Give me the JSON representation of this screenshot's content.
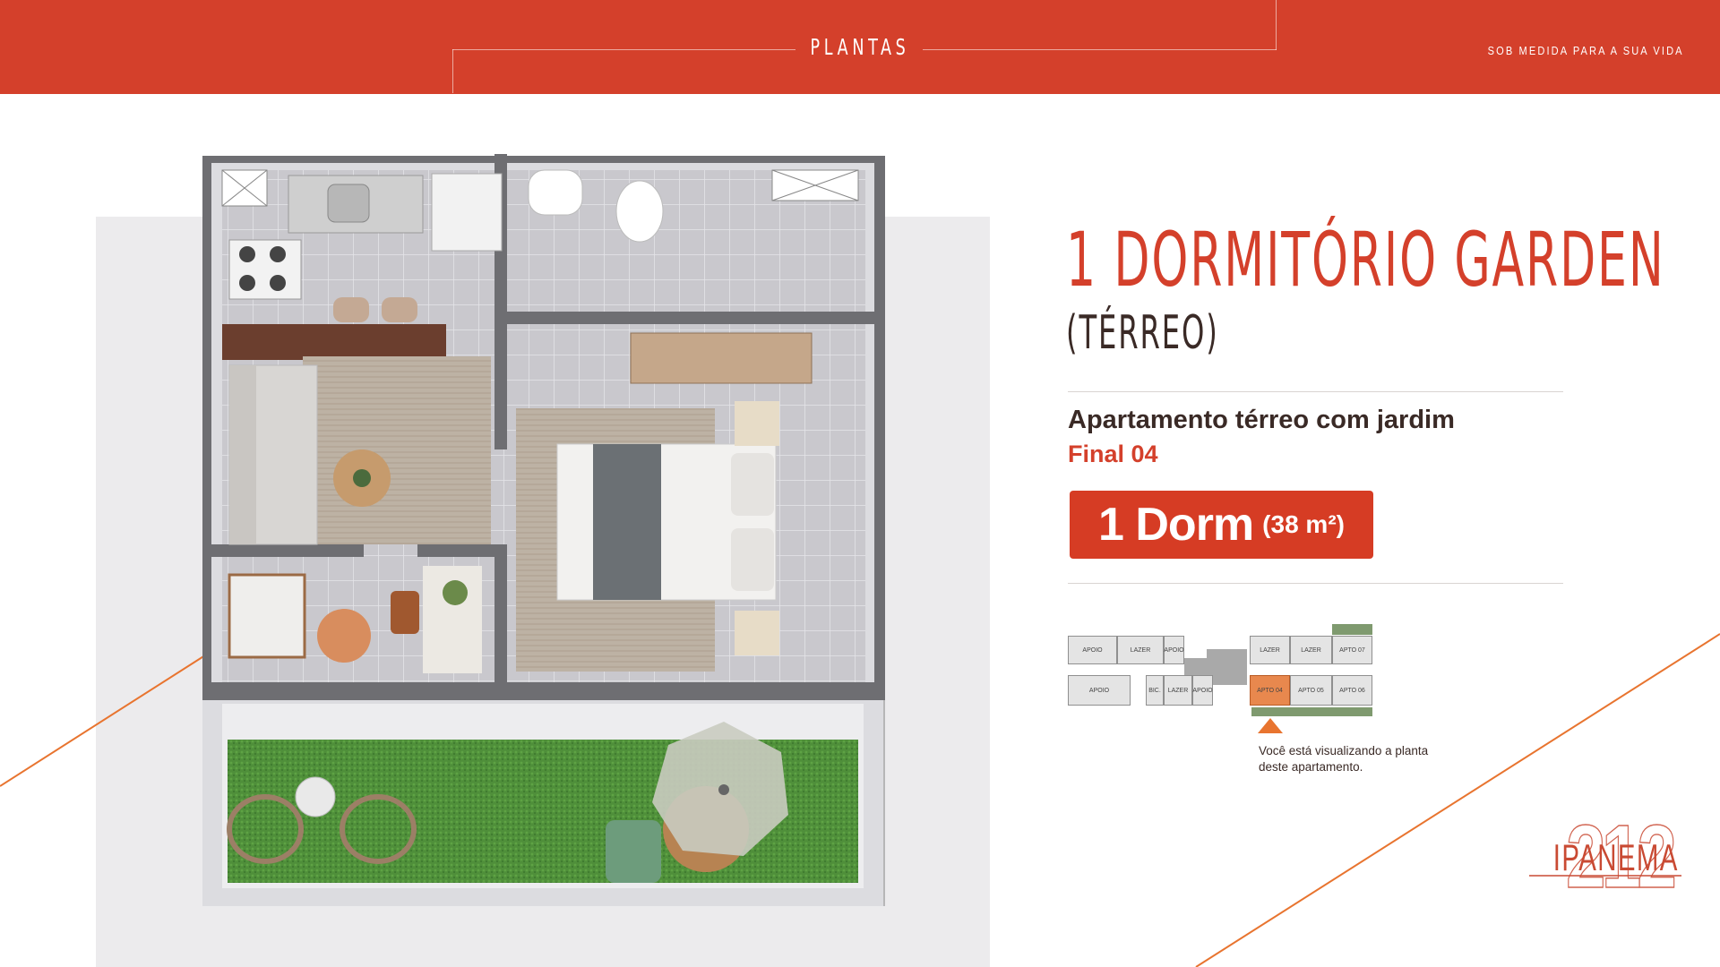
{
  "header": {
    "section_title": "PLANTAS",
    "tagline": "SOB MEDIDA PARA A SUA VIDA"
  },
  "colors": {
    "brand_red": "#d4402b",
    "accent_orange": "#e8742f",
    "dark_text": "#3a2a26",
    "panel_gray": "#ecebed"
  },
  "unit": {
    "title": "1 DORMITÓRIO GARDEN",
    "subtitle": "(TÉRREO)",
    "description": "Apartamento térreo com jardim",
    "final": "Final 04",
    "badge_label": "1 Dorm",
    "badge_area": "(38 m²)"
  },
  "keyplan": {
    "top_row": [
      "APOIO",
      "LAZER",
      "APOIO",
      "LAZER",
      "LAZER",
      "APTO 07"
    ],
    "bottom_row": [
      "APOIO",
      "BIC.",
      "LAZER",
      "APOIO",
      "APTO 04",
      "APTO 05",
      "APTO 06"
    ],
    "highlight": "APTO 04",
    "caption": "Você está visualizando a planta deste apartamento."
  },
  "logo": {
    "word": "IPANEMA",
    "number": "212"
  },
  "floorplan": {
    "rooms": [
      "kitchen",
      "living-room",
      "bathroom",
      "bedroom",
      "balcony",
      "garden"
    ]
  }
}
